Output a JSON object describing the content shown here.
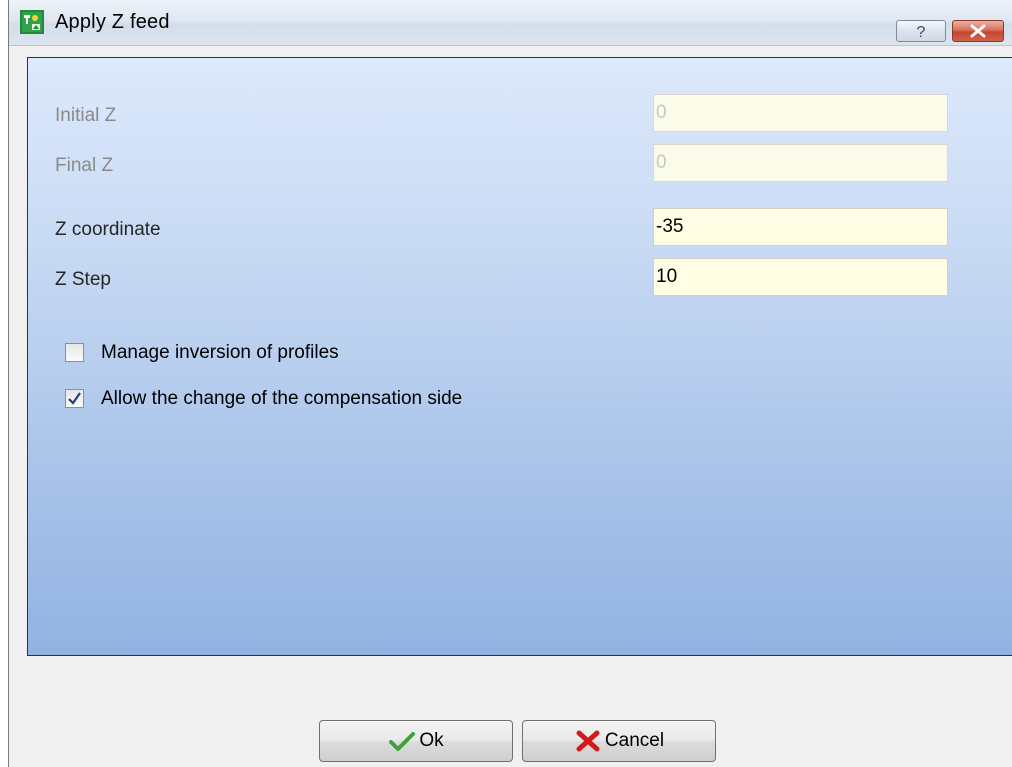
{
  "window": {
    "title": "Apply Z feed",
    "help_label": "?",
    "close_label": "×"
  },
  "fields": {
    "initial_z": {
      "label": "Initial Z",
      "value": "0",
      "enabled": false
    },
    "final_z": {
      "label": "Final Z",
      "value": "0",
      "enabled": false
    },
    "z_coordinate": {
      "label": "Z coordinate",
      "value": "-35",
      "enabled": true
    },
    "z_step": {
      "label": "Z Step",
      "value": "10",
      "enabled": true
    }
  },
  "options": {
    "manage_inversion": {
      "label": "Manage inversion of profiles",
      "checked": false
    },
    "allow_compensation_change": {
      "label": "Allow the change of the compensation side",
      "checked": true
    }
  },
  "buttons": {
    "ok": {
      "label": "Ok",
      "icon": "check-icon"
    },
    "cancel": {
      "label": "Cancel",
      "icon": "x-cross-icon"
    }
  },
  "colors": {
    "field_background": "#fffde4",
    "panel_top": "#dde9fc",
    "panel_bottom": "#92b2e2",
    "check_green": "#3ca33c",
    "cancel_red": "#d11a1a"
  }
}
